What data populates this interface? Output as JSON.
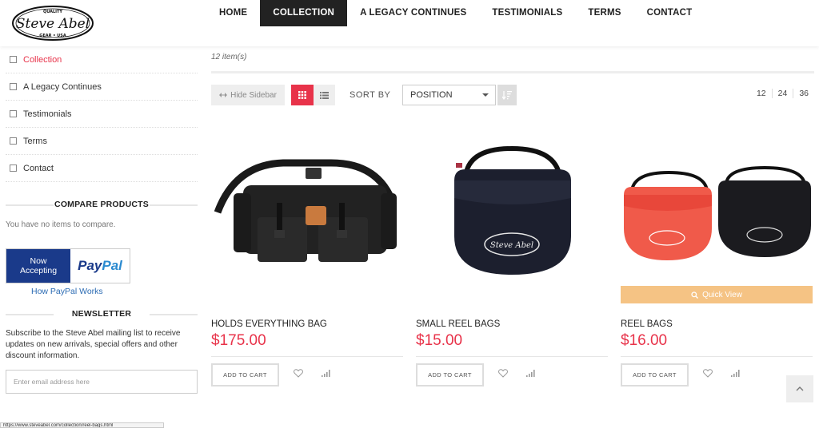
{
  "logo": {
    "top": "QUALITY",
    "main": "Steve Abel",
    "bottom": "GEAR • USA"
  },
  "nav": {
    "items": [
      "HOME",
      "COLLECTION",
      "A LEGACY CONTINUES",
      "TESTIMONIALS",
      "TERMS",
      "CONTACT"
    ],
    "active_index": 1
  },
  "sidebar": {
    "categories": [
      "Collection",
      "A Legacy Continues",
      "Testimonials",
      "Terms",
      "Contact"
    ],
    "active_category_index": 0,
    "compare_title": "COMPARE PRODUCTS",
    "compare_text": "You have no items to compare.",
    "paypal": {
      "left_line1": "Now",
      "left_line2": "Accepting",
      "brand_pay": "Pay",
      "brand_pal": "Pal"
    },
    "paypal_link": "How PayPal Works",
    "newsletter_title": "NEWSLETTER",
    "newsletter_text": "Subscribe to the Steve Abel mailing list to receive updates on new arrivals, special offers and other discount information.",
    "email_placeholder": "Enter email address here"
  },
  "main": {
    "item_count": "12 item(s)",
    "hide_sidebar": "Hide Sidebar",
    "sort_by_label": "SORT BY",
    "sort_value": "POSITION",
    "per_page": [
      "12",
      "24",
      "36"
    ],
    "products": [
      {
        "name": "HOLDS EVERYTHING BAG",
        "price": "$175.00",
        "add_to_cart": "ADD TO CART"
      },
      {
        "name": "SMALL REEL BAGS",
        "price": "$15.00",
        "add_to_cart": "ADD TO CART"
      },
      {
        "name": "REEL BAGS",
        "price": "$16.00",
        "add_to_cart": "ADD TO CART",
        "quick_view": "Quick View"
      }
    ]
  },
  "status_bar": "https://www.steveabel.com/collection/reel-bags.html",
  "colors": {
    "accent": "#e8334a",
    "nav_active_bg": "#222222",
    "quick_view_bg": "#f5c384",
    "paypal_blue": "#1a3a8a"
  },
  "icons": [
    "hamburger-grid-icon",
    "list-icon",
    "sort-direction-icon",
    "heart-icon",
    "compare-bars-icon",
    "search-icon",
    "chevron-up-icon",
    "arrows-hide-icon"
  ]
}
